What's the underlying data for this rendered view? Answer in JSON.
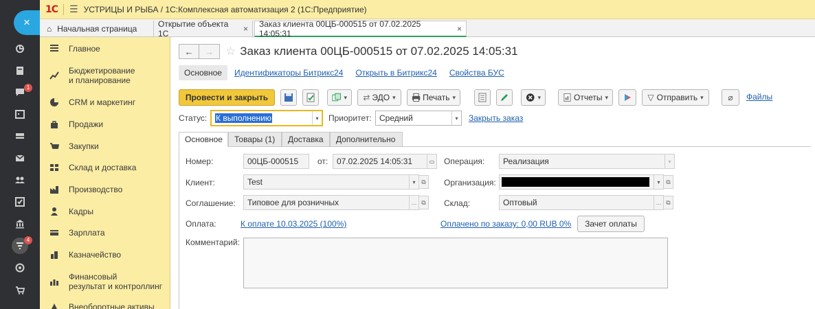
{
  "app": {
    "logo": "1С",
    "title": "УСТРИЦЫ И РЫБА / 1С:Комплексная автоматизация 2  (1С:Предприятие)"
  },
  "leftbar": {
    "close": "×",
    "badges": [
      "1",
      "4"
    ]
  },
  "sections": [
    {
      "icon": "menu-icon",
      "label": "Главное"
    },
    {
      "icon": "budget-icon",
      "label": "Бюджетирование",
      "label2": "и планирование"
    },
    {
      "icon": "crm-icon",
      "label": "CRM и маркетинг"
    },
    {
      "icon": "bag-icon",
      "label": "Продажи"
    },
    {
      "icon": "cart-icon",
      "label": "Закупки"
    },
    {
      "icon": "warehouse-icon",
      "label": "Склад и доставка"
    },
    {
      "icon": "factory-icon",
      "label": "Производство"
    },
    {
      "icon": "person-icon",
      "label": "Кадры"
    },
    {
      "icon": "salary-icon",
      "label": "Зарплата"
    },
    {
      "icon": "treasury-icon",
      "label": "Казначейство"
    },
    {
      "icon": "chart-icon",
      "label": "Финансовый",
      "label2": "результат и контроллинг"
    },
    {
      "icon": "assets-icon",
      "label": "Внеоборотные активы"
    }
  ],
  "tabs": [
    {
      "label": "Начальная страница",
      "closable": false
    },
    {
      "label": "Открытие объекта 1С",
      "closable": true
    },
    {
      "label": "Заказ клиента 00ЦБ-000515 от 07.02.2025 14:05:31",
      "closable": true,
      "active": true
    }
  ],
  "form": {
    "title": "Заказ клиента 00ЦБ-000515 от 07.02.2025 14:05:31",
    "nav": {
      "back": "←",
      "forward": "→"
    },
    "links": {
      "main": "Основное",
      "ids": "Идентификаторы Битрикс24",
      "open": "Открыть в Битрикс24",
      "props": "Свойства БУС"
    },
    "toolbar": {
      "post_close": "Провести и закрыть",
      "edo": "ЭДО",
      "print": "Печать",
      "reports": "Отчеты",
      "send": "Отправить",
      "files": "Файлы"
    },
    "status": {
      "label": "Статус:",
      "value": "К выполнению",
      "priority_label": "Приоритет:",
      "priority_value": "Средний",
      "close_order": "Закрыть заказ"
    },
    "inner_tabs": [
      "Основное",
      "Товары (1)",
      "Доставка",
      "Дополнительно"
    ],
    "fields": {
      "number_label": "Номер:",
      "number": "00ЦБ-000515",
      "from_label": "от:",
      "date": "07.02.2025 14:05:31",
      "operation_label": "Операция:",
      "operation": "Реализация",
      "client_label": "Клиент:",
      "client": "Test",
      "org_label": "Организация:",
      "agreement_label": "Соглашение:",
      "agreement": "Типовое для розничных",
      "warehouse_label": "Склад:",
      "warehouse": "Оптовый",
      "payment_label": "Оплата:",
      "payment_link": "К оплате 10.03.2025 (100%)",
      "paid_link": "Оплачено по заказу: 0,00 RUB 0%",
      "offset_button": "Зачет оплаты",
      "comment_label": "Комментарий:"
    }
  },
  "colors": {
    "accent_yellow": "#fbeda4",
    "primary_button": "#f2c83b",
    "link": "#1f5fb0",
    "active_tab_underline": "#2ca05a",
    "close_button": "#2aa7e0",
    "sidebar_dark": "#2e3033"
  }
}
